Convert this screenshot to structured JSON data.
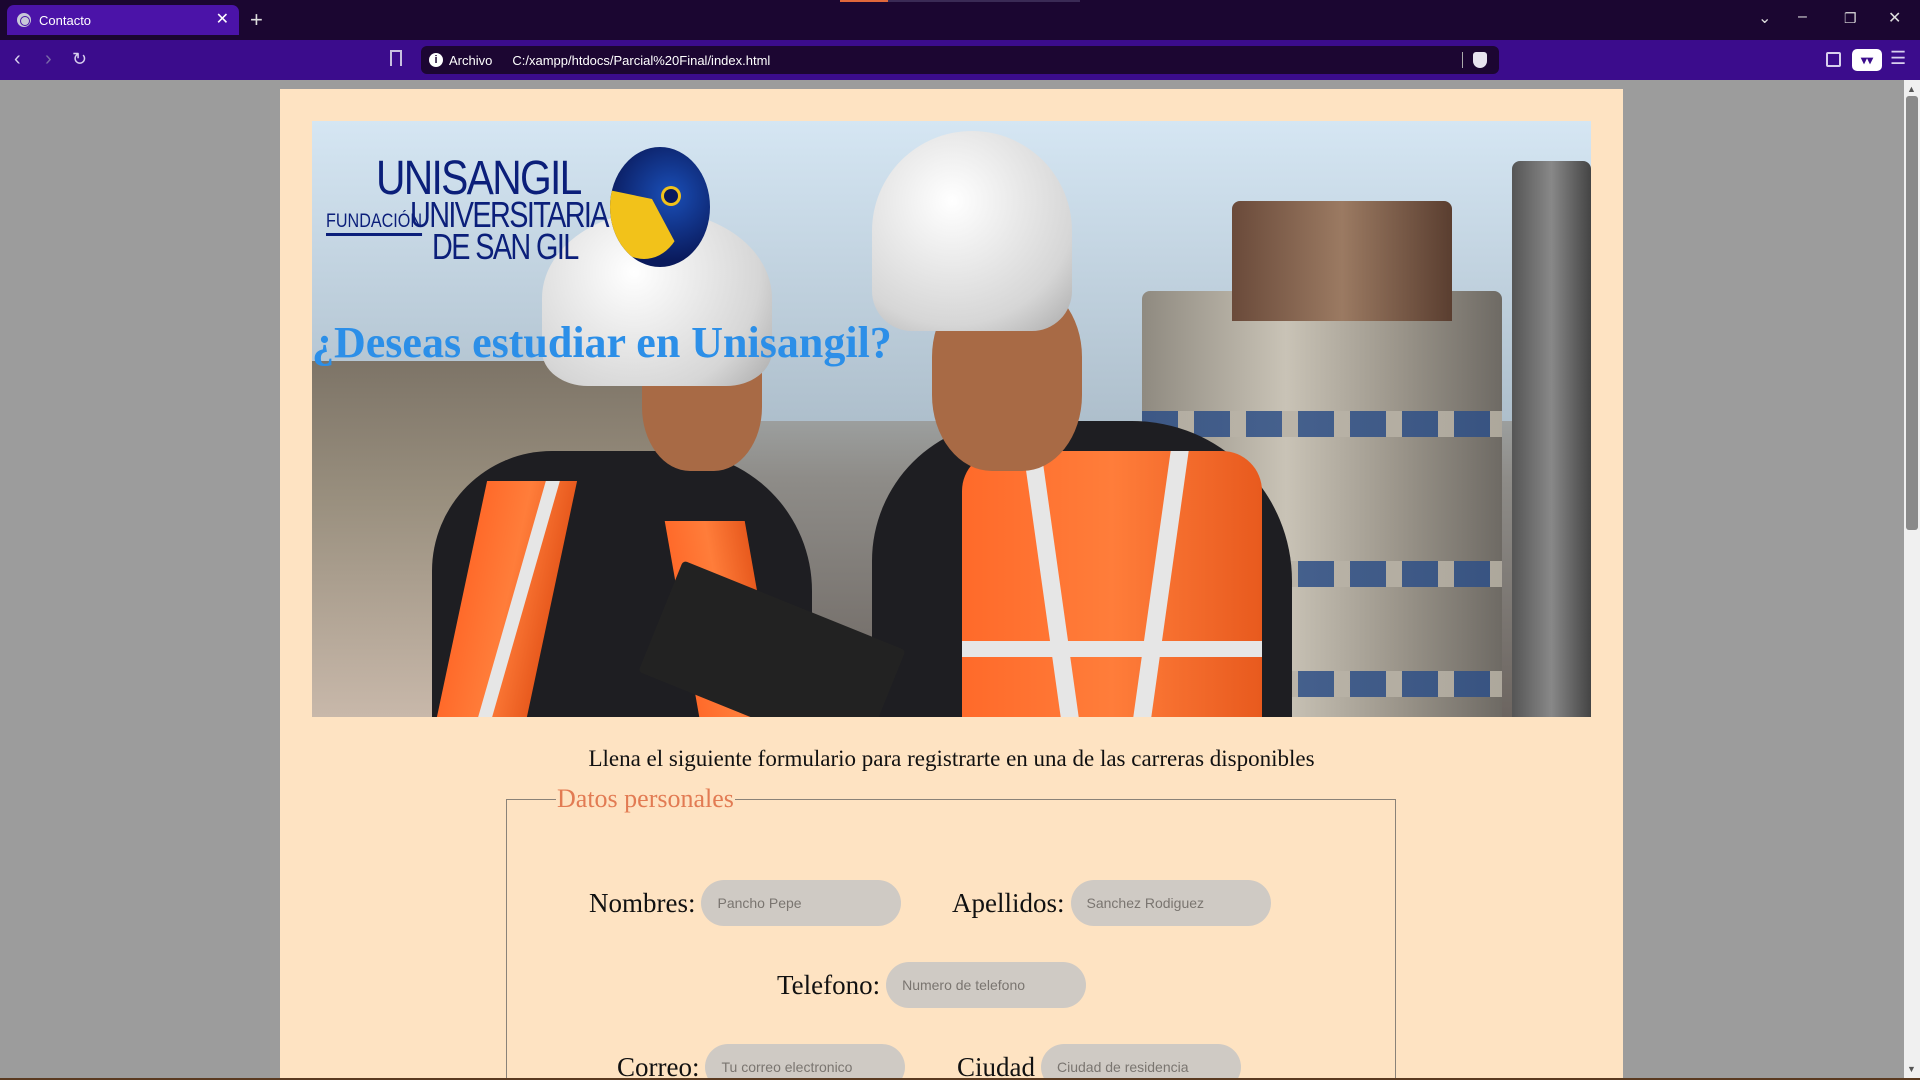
{
  "browser": {
    "tab_title": "Contacto",
    "tab_close": "✕",
    "new_tab": "+",
    "url_scheme_label": "Archivo",
    "url": "C:/xampp/htdocs/Parcial%20Final/index.html"
  },
  "page": {
    "logo": {
      "unisangil": "UNISANGIL",
      "fundacion": "FUNDACIÓN",
      "universitaria": "UNIVERSITARIA",
      "de_san_gil": "DE SAN GIL"
    },
    "banner_title": "¿Deseas estudiar en Unisangil?",
    "intro": "Llena el siguiente formulario para registrarte en una de las carreras disponibles",
    "form": {
      "legend": "Datos personales",
      "nombres": {
        "label": "Nombres:",
        "placeholder": "Pancho Pepe"
      },
      "apellidos": {
        "label": "Apellidos:",
        "placeholder": "Sanchez Rodiguez"
      },
      "telefono": {
        "label": "Telefono:",
        "placeholder": "Numero de telefono"
      },
      "correo": {
        "label": "Correo:",
        "placeholder": "Tu correo electronico"
      },
      "ciudad": {
        "label": "Ciudad",
        "placeholder": "Ciudad de residencia"
      }
    }
  },
  "colors": {
    "tabbar": "#1b0631",
    "toolbar": "#3b0c8c",
    "page_bg": "#fee3c2",
    "banner_title": "#2c8fe8",
    "legend": "#e27b53",
    "input_bg": "#cfcac4"
  },
  "icons": [
    "globe-icon",
    "close-icon",
    "plus-icon",
    "chevron-down-icon",
    "minimize-icon",
    "restore-icon",
    "back-icon",
    "forward-icon",
    "reload-icon",
    "bookmark-icon",
    "info-icon",
    "brave-shield-icon",
    "sidebar-icon",
    "extension-icon",
    "menu-icon"
  ]
}
